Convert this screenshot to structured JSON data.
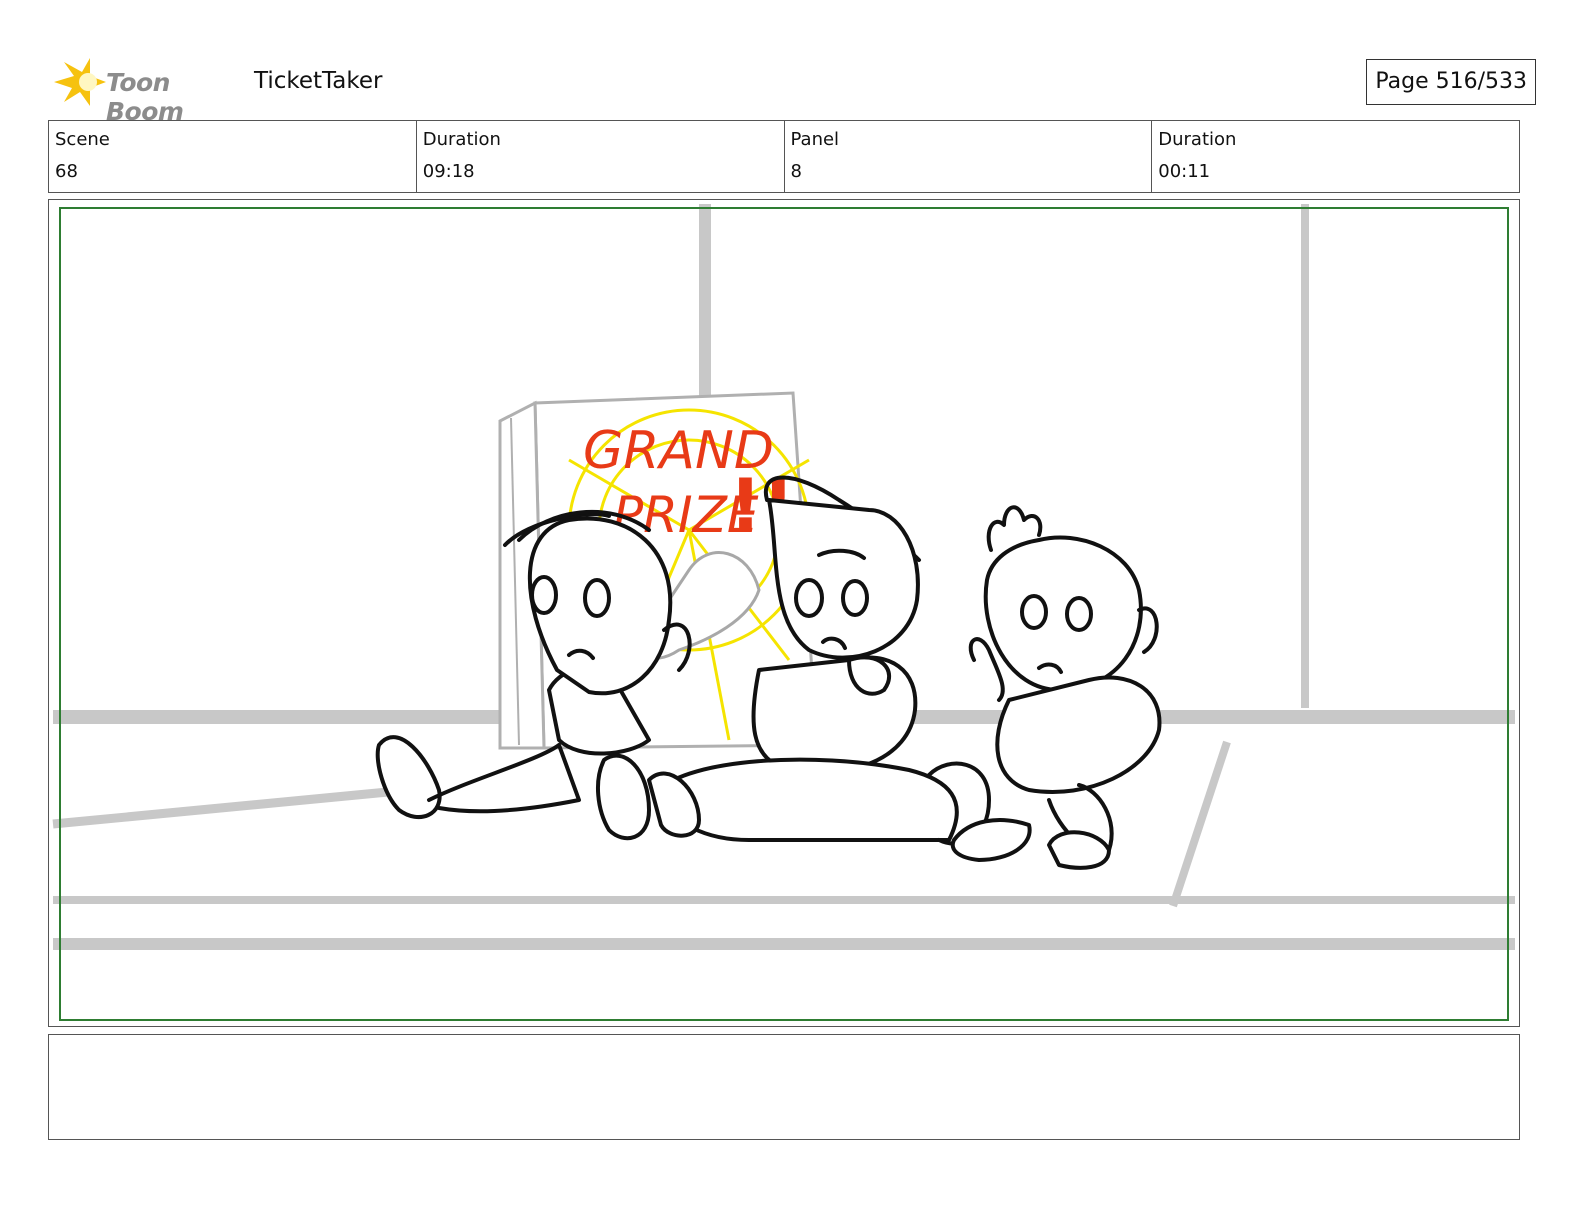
{
  "header": {
    "logo_text": "Toon Boom",
    "project_title": "TicketTaker",
    "page_label": "Page 516/533"
  },
  "info": {
    "scene_label": "Scene",
    "scene_value": "68",
    "scene_duration_label": "Duration",
    "scene_duration_value": "09:18",
    "panel_label": "Panel",
    "panel_value": "8",
    "panel_duration_label": "Duration",
    "panel_duration_value": "00:11"
  },
  "panel": {
    "sign_line1": "GRAND",
    "sign_line2": "PRIZE",
    "sign_exclaim": "!!"
  },
  "colors": {
    "safe_area": "#2e7d32",
    "sign_text": "#e83a17",
    "burst": "#f5e400",
    "bg_lines": "#c8c8c8"
  }
}
